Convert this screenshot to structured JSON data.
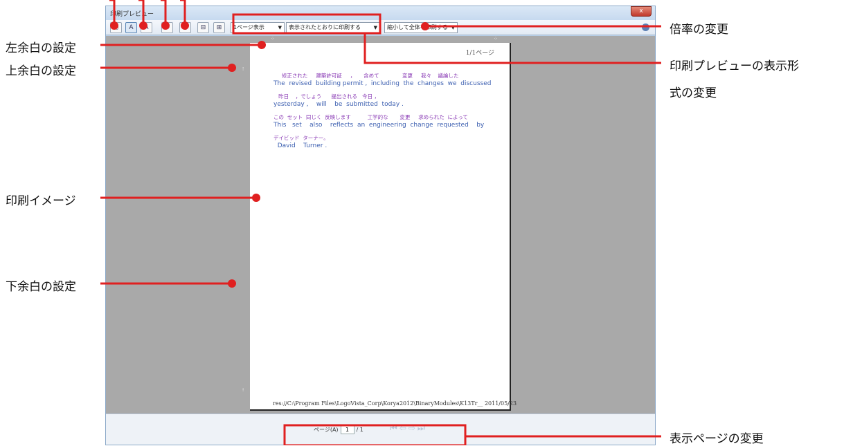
{
  "window": {
    "title": "印刷プレビュー",
    "close_label": "x"
  },
  "toolbar": {
    "view_mode": "1ページ表示",
    "print_mode": "表示されたとおりに印刷する",
    "zoom_mode": "縮小して全体を印刷する",
    "buttons": [
      "printer-icon",
      "portrait-icon",
      "landscape-icon",
      "settings-icon",
      "single-page-icon",
      "page-width-icon",
      "full-page-icon"
    ]
  },
  "page": {
    "number_label": "1/1ページ",
    "lines": [
      {
        "jp": "     修正された     建築許可証     ，     含めて              変更     我々    議論した",
        "en": "The  revised  building permit ,  including  the  changes  we  discussed"
      },
      {
        "jp": "   昨日    ，でしょう      提出される   今日 ，",
        "en": "yesterday ,    will    be  submitted  today ."
      },
      {
        "jp": "この  セット  同じく  反映します          工学的な       変更     求められた  によって",
        "en": "This   set    also    reflects  an  engineering  change  requested    by"
      },
      {
        "jp": "デイビッド  ターナー。",
        "en": "  David    Turner ."
      }
    ],
    "footer": "res://C:\\Program Files\\LogoVista_Corp\\Korya2012\\BinaryModules\\K13Tr__ 2011/05/23"
  },
  "statusbar": {
    "page_label": "ページ(A)",
    "page_value": "1",
    "page_total": "/ 1",
    "nav_glyphs": "⏮⇦⇨⏭"
  },
  "annotations": {
    "zoom_change": "倍率の変更",
    "left_margin": "左余白の設定",
    "top_margin": "上余白の設定",
    "display_format_line1": "印刷プレビューの表示形",
    "display_format_line2": "式の変更",
    "print_image": "印刷イメージ",
    "bottom_margin": "下余白の設定",
    "page_change": "表示ページの変更"
  },
  "colors": {
    "annotation_red": "#e02020",
    "preview_gray": "#a9a9a9",
    "jp_text": "#8a3bb5",
    "en_text": "#3c5fb0"
  }
}
